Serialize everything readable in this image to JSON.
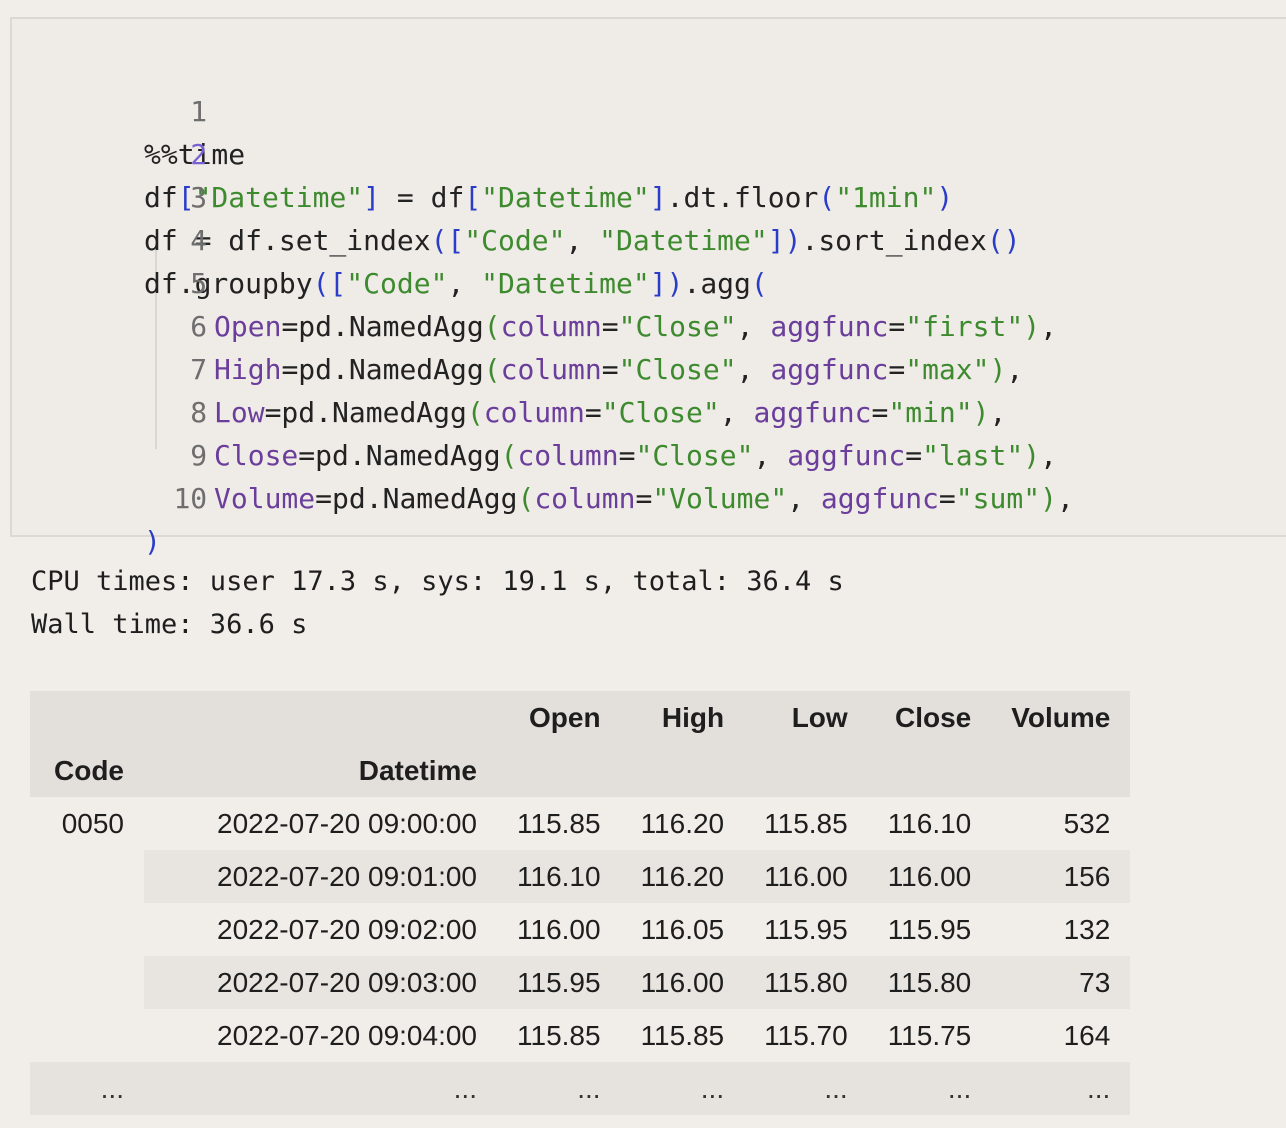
{
  "cell": {
    "line_numbers": [
      "1",
      "2",
      "3",
      "4",
      "5",
      "6",
      "7",
      "8",
      "9",
      "10"
    ],
    "code": {
      "l1": "%%time",
      "l2_a": "df",
      "l2_b": "[",
      "l2_c": "\"Datetime\"",
      "l2_d": "]",
      "l2_e": " = df",
      "l2_f": "[",
      "l2_g": "\"Datetime\"",
      "l2_h": "]",
      "l2_i": ".dt.floor",
      "l2_j": "(",
      "l2_k": "\"1min\"",
      "l2_l": ")",
      "l3_a": "df = df.set_index",
      "l3_b": "([",
      "l3_c": "\"Code\"",
      "l3_d": ", ",
      "l3_e": "\"Datetime\"",
      "l3_f": "])",
      "l3_g": ".sort_index",
      "l3_h": "()",
      "l4_a": "df.groupby",
      "l4_b": "([",
      "l4_c": "\"Code\"",
      "l4_d": ", ",
      "l4_e": "\"Datetime\"",
      "l4_f": "])",
      "l4_g": ".agg",
      "l4_h": "(",
      "l5_name": "Open",
      "l5_eq": "=pd.NamedAgg",
      "l5_p1": "(",
      "l5_col": "column",
      "l5_eq2": "=",
      "l5_colv": "\"Close\"",
      "l5_sep": ", ",
      "l5_agg": "aggfunc",
      "l5_eq3": "=",
      "l5_aggv": "\"first\"",
      "l5_p2": ")",
      "l5_end": ",",
      "l6_name": "High",
      "l6_eq": "=pd.NamedAgg",
      "l6_p1": "(",
      "l6_col": "column",
      "l6_eq2": "=",
      "l6_colv": "\"Close\"",
      "l6_sep": ", ",
      "l6_agg": "aggfunc",
      "l6_eq3": "=",
      "l6_aggv": "\"max\"",
      "l6_p2": ")",
      "l6_end": ",",
      "l7_name": "Low",
      "l7_eq": "=pd.NamedAgg",
      "l7_p1": "(",
      "l7_col": "column",
      "l7_eq2": "=",
      "l7_colv": "\"Close\"",
      "l7_sep": ", ",
      "l7_agg": "aggfunc",
      "l7_eq3": "=",
      "l7_aggv": "\"min\"",
      "l7_p2": ")",
      "l7_end": ",",
      "l8_name": "Close",
      "l8_eq": "=pd.NamedAgg",
      "l8_p1": "(",
      "l8_col": "column",
      "l8_eq2": "=",
      "l8_colv": "\"Close\"",
      "l8_sep": ", ",
      "l8_agg": "aggfunc",
      "l8_eq3": "=",
      "l8_aggv": "\"last\"",
      "l8_p2": ")",
      "l8_end": ",",
      "l9_name": "Volume",
      "l9_eq": "=pd.NamedAgg",
      "l9_p1": "(",
      "l9_col": "column",
      "l9_eq2": "=",
      "l9_colv": "\"Volume\"",
      "l9_sep": ", ",
      "l9_agg": "aggfunc",
      "l9_eq3": "=",
      "l9_aggv": "\"sum\"",
      "l9_p2": ")",
      "l9_end": ",",
      "l10": ")"
    }
  },
  "output": {
    "cpu_times": "CPU times: user 17.3 s, sys: 19.1 s, total: 36.4 s",
    "wall_time": "Wall time: 36.6 s"
  },
  "table": {
    "columns": [
      "Open",
      "High",
      "Low",
      "Close",
      "Volume"
    ],
    "index_names": [
      "Code",
      "Datetime"
    ],
    "rows": [
      {
        "code": "0050",
        "dt": "2022-07-20 09:00:00",
        "open": "115.85",
        "high": "116.20",
        "low": "115.85",
        "close": "116.10",
        "volume": "532"
      },
      {
        "code": "",
        "dt": "2022-07-20 09:01:00",
        "open": "116.10",
        "high": "116.20",
        "low": "116.00",
        "close": "116.00",
        "volume": "156"
      },
      {
        "code": "",
        "dt": "2022-07-20 09:02:00",
        "open": "116.00",
        "high": "116.05",
        "low": "115.95",
        "close": "115.95",
        "volume": "132"
      },
      {
        "code": "",
        "dt": "2022-07-20 09:03:00",
        "open": "115.95",
        "high": "116.00",
        "low": "115.80",
        "close": "115.80",
        "volume": "73"
      },
      {
        "code": "",
        "dt": "2022-07-20 09:04:00",
        "open": "115.85",
        "high": "115.85",
        "low": "115.70",
        "close": "115.75",
        "volume": "164"
      }
    ],
    "ellipsis": "..."
  }
}
